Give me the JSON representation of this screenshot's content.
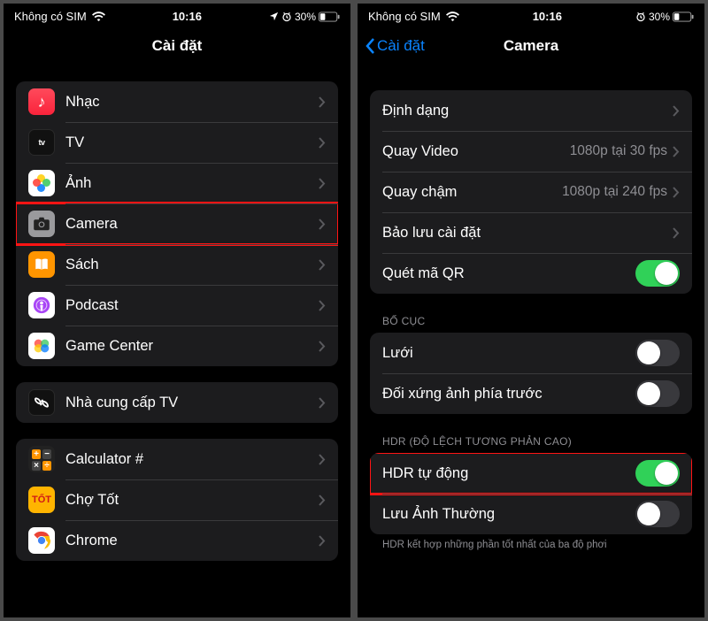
{
  "status": {
    "carrier": "Không có SIM",
    "time": "10:16",
    "battery": "30%"
  },
  "left_screen": {
    "title": "Cài đặt",
    "group1": {
      "items": [
        {
          "label": "Nhạc"
        },
        {
          "label": "TV"
        },
        {
          "label": "Ảnh"
        },
        {
          "label": "Camera",
          "highlight": true
        },
        {
          "label": "Sách"
        },
        {
          "label": "Podcast"
        },
        {
          "label": "Game Center"
        }
      ]
    },
    "group2": {
      "items": [
        {
          "label": "Nhà cung cấp TV"
        }
      ]
    },
    "group3": {
      "items": [
        {
          "label": "Calculator #"
        },
        {
          "label": "Chợ Tốt"
        },
        {
          "label": "Chrome"
        }
      ]
    }
  },
  "right_screen": {
    "back_label": "Cài đặt",
    "title": "Camera",
    "group1": {
      "items": [
        {
          "label": "Định dạng",
          "type": "nav"
        },
        {
          "label": "Quay Video",
          "value": "1080p tại 30 fps",
          "type": "nav"
        },
        {
          "label": "Quay chậm",
          "value": "1080p tại 240 fps",
          "type": "nav"
        },
        {
          "label": "Bảo lưu cài đặt",
          "type": "nav"
        },
        {
          "label": "Quét mã QR",
          "type": "toggle",
          "on": true
        }
      ]
    },
    "section2_header": "BỐ CỤC",
    "group2": {
      "items": [
        {
          "label": "Lưới",
          "type": "toggle",
          "on": false
        },
        {
          "label": "Đối xứng ảnh phía trước",
          "type": "toggle",
          "on": false
        }
      ]
    },
    "section3_header": "HDR (ĐỘ LỆCH TƯƠNG PHẢN CAO)",
    "group3": {
      "items": [
        {
          "label": "HDR tự động",
          "type": "toggle",
          "on": true,
          "highlight": true
        },
        {
          "label": "Lưu Ảnh Thường",
          "type": "toggle",
          "on": false
        }
      ]
    },
    "footer": "HDR kết hợp những phần tốt nhất của ba độ phơi"
  }
}
